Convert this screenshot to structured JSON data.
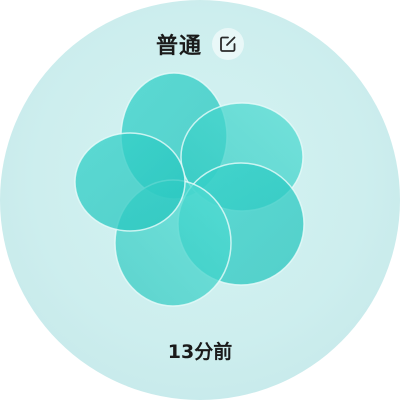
{
  "header": {
    "mode_label": "普通",
    "edit_icon": "edit-icon"
  },
  "graphic": {
    "name": "breathing-flower",
    "petal_colors": [
      "#33cfc8",
      "#46d9cf",
      "#5fe2d9"
    ]
  },
  "footer": {
    "timestamp": "13分前"
  }
}
